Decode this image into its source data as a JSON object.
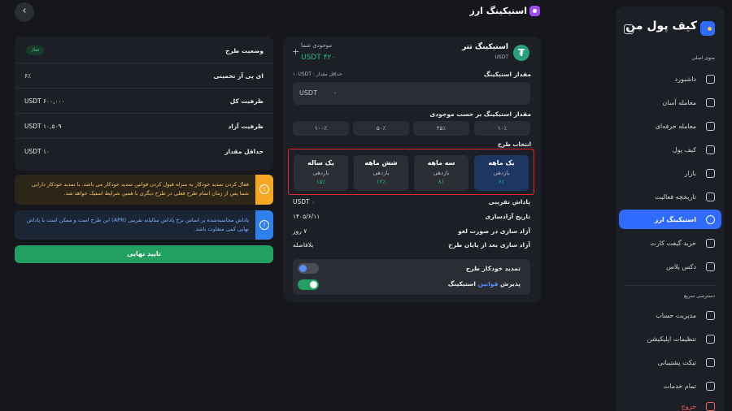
{
  "header": {
    "title": "استیکینگ ارز",
    "back_glyph": "‹"
  },
  "sidebar": {
    "logo": "کیف پول من",
    "main_menu_label": "منوی اصلی",
    "items": [
      {
        "label": "داشبورد",
        "icon": "dashboard-icon"
      },
      {
        "label": "معامله آسان",
        "icon": "easy-trade-icon"
      },
      {
        "label": "معامله حرفه‌ای",
        "icon": "pro-trade-icon"
      },
      {
        "label": "کیف پول",
        "icon": "wallet-icon"
      },
      {
        "label": "بازار",
        "icon": "market-icon"
      },
      {
        "label": "تاریخچه فعالیت",
        "icon": "history-icon"
      },
      {
        "label": "استیکینگ ارز",
        "icon": "staking-icon",
        "active": true
      },
      {
        "label": "خرید گیفت کارت",
        "icon": "gift-card-icon"
      },
      {
        "label": "دکس پلاس",
        "icon": "dex-plus-icon"
      }
    ],
    "quick_access_label": "دسترسی سریع",
    "quick_items": [
      {
        "label": "مدیریت حساب",
        "icon": "account-icon"
      },
      {
        "label": "تنظیمات اپلیکیشن",
        "icon": "settings-icon"
      },
      {
        "label": "تیکت پشتیبانی",
        "icon": "support-ticket-icon"
      },
      {
        "label": "تمام خدمات",
        "icon": "services-icon"
      }
    ],
    "logout": "خروج"
  },
  "staking": {
    "coin_name": "استیکینگ تتر",
    "coin_symbol": "USDT",
    "coin_glyph": "₮",
    "balance_label": "موجودی شما",
    "balance_value": "۴۲۰ USDT",
    "plus_glyph": "+",
    "amount_label": "مقدار استیکینگ",
    "min_amount": "حداقل مقدار : ۱۰USDT",
    "input_unit": "USDT",
    "input_value": "۰",
    "percent_label": "مقدار استیکینگ بر حسب موجودی",
    "percents": [
      "۱۰٪",
      "۲۵٪",
      "۵۰٪",
      "۱۰۰٪"
    ],
    "plan_label": "انتخاب طرح",
    "plans": [
      {
        "name": "یک ماهه",
        "yield_label": "بازدهی",
        "yield": "۶٪",
        "selected": true
      },
      {
        "name": "سه ماهه",
        "yield_label": "بازدهی",
        "yield": "۸٪"
      },
      {
        "name": "شش ماهه",
        "yield_label": "بازدهی",
        "yield": "۱۲٪"
      },
      {
        "name": "یک ساله",
        "yield_label": "بازدهی",
        "yield": "۱۵٪"
      }
    ],
    "info": [
      {
        "label": "پاداش تقریبی",
        "value": "۰ USDT"
      },
      {
        "label": "تاریخ آزادسازی",
        "value": "۱۴۰۵/۶/۱۱"
      },
      {
        "label": "آزاد سازی در صورت لغو",
        "value": "۷ روز"
      },
      {
        "label": "آزاد سازی بعد از پایان طرح",
        "value": "بلافاصله"
      }
    ],
    "auto_renew_label": "تمدید خودکار طرح",
    "accept_prefix": "پذیرش",
    "accept_link": "قوانین",
    "accept_suffix": "استیکینگ",
    "auto_renew_on": false,
    "accept_on": true
  },
  "summary": {
    "rows": [
      {
        "label": "وضعیت طرح",
        "badge": "فعال"
      },
      {
        "label": "ای پی آر تخمینی",
        "value": "۶٪"
      },
      {
        "label": "ظرفیت کل",
        "value": "۶۰۰,۰۰۰ USDT"
      },
      {
        "label": "ظرفیت آزاد",
        "value": "۱۰,۵۰۹ USDT"
      },
      {
        "label": "حداقل مقدار",
        "value": "۱۰ USDT"
      }
    ],
    "warning_text": "فعال کردن تمدید خودکار به منزله قبول کردن قوانین تمدید خودکار می باشد. با تمدید خودکار دارایی شما پس از زمان اتمام طرح فعلی در طرح دیگری با همین شرایط استیک خواهد شد.",
    "info_text": "پاداش محاسبه‌شده بر اساس نرخ پاداش سالیانه تقریبی (APR) این طرح است و ممکن است با پاداش نهایی کمی متفاوت باشد.",
    "alert_glyph": "!",
    "confirm_label": "تایید نهایی"
  },
  "colors": {
    "accent": "#2f6bff",
    "success": "#21a062",
    "warning": "#f5a623",
    "info": "#2f80ed",
    "highlight": "#e5262e"
  }
}
